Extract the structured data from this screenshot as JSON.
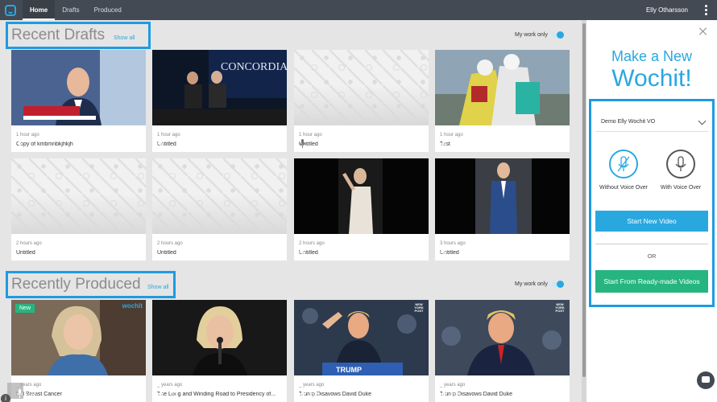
{
  "nav": {
    "tabs": [
      "Home",
      "Drafts",
      "Produced"
    ],
    "user": "Elly Otharsson"
  },
  "recent_drafts": {
    "title": "Recent Drafts",
    "show_all": "Show all",
    "toggle_label": "My work only",
    "cards": [
      {
        "time": "1 hour ago",
        "title": "Copy of kmbmnbkjhkjh"
      },
      {
        "time": "1 hour ago",
        "title": "Untitled"
      },
      {
        "time": "1 hour ago",
        "title": "Untitled"
      },
      {
        "time": "1 hour ago",
        "title": "Test"
      },
      {
        "time": "2 hours ago",
        "title": "Untitled"
      },
      {
        "time": "2 hours ago",
        "title": "Untitled"
      },
      {
        "time": "2 hours ago",
        "title": "Untitled"
      },
      {
        "time": "3 hours ago",
        "title": "Untitled"
      }
    ]
  },
  "recently_produced": {
    "title": "Recently Produced",
    "show_all": "Show all",
    "toggle_label": "My work only",
    "cards": [
      {
        "time": "_ years ago",
        "title": "NH Breast Cancer",
        "duration": "0:36",
        "badge": "New",
        "watermark": "wochit"
      },
      {
        "time": "_ years ago",
        "title": "The Long and Winding Road to Presidency of...",
        "duration": "1:13"
      },
      {
        "time": "_ years ago",
        "title": "Trump Disavows David Duke",
        "duration": "0:35",
        "watermark": "NEW YORK POST"
      },
      {
        "time": "_ years ago",
        "title": "Trump Disavows David Duke",
        "duration": "0:35",
        "watermark": "NEW YORK POST"
      }
    ]
  },
  "panel": {
    "heading_line1": "Make a New",
    "heading_line2": "Wochit!",
    "voice_select": "Demo Elly Wochit VO",
    "without_vo": "Without Voice Over",
    "with_vo": "With Voice Over",
    "start_new": "Start New Video",
    "or": "OR",
    "start_ready": "Start From Ready-made Videos"
  },
  "colors": {
    "accent": "#29a8e0",
    "green": "#26b580",
    "nav_bg": "#434a54",
    "highlight": "#1e9be0"
  }
}
